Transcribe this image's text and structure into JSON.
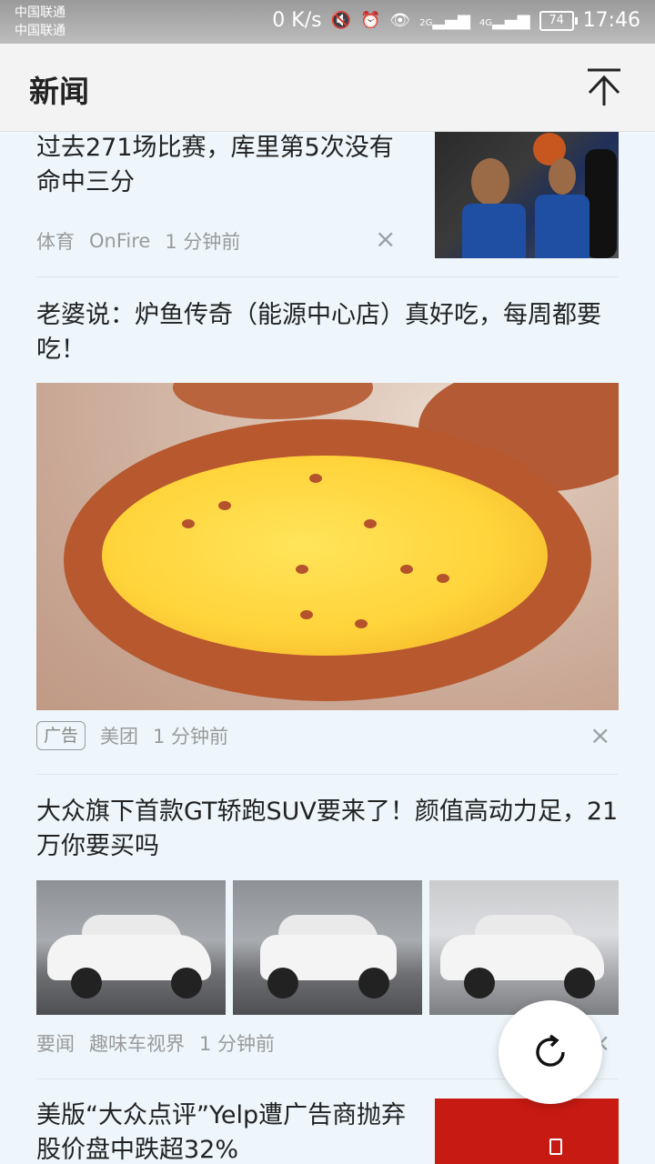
{
  "status_bar": {
    "carrier_1": "中国联通",
    "carrier_2": "中国联通",
    "speed": "0 K/s",
    "network_1": "2G",
    "network_2": "4G",
    "battery": "74",
    "time": "17:46"
  },
  "app_bar": {
    "title": "新闻",
    "back_to_top_icon": "arrow-up-to-top-icon"
  },
  "feed": [
    {
      "headline": "过去271场比赛，库里第5次没有命中三分",
      "category": "体育",
      "source": "OnFire",
      "time": "1 分钟前",
      "close": "×"
    },
    {
      "headline": "老婆说：炉鱼传奇（能源中心店）真好吃，每周都要吃！",
      "badge": "广告",
      "source": "美团",
      "time": "1 分钟前",
      "close": "×"
    },
    {
      "headline": "大众旗下首款GT轿跑SUV要来了！颜值高动力足，21万你要买吗",
      "category": "要闻",
      "source": "趣味车视界",
      "time": "1 分钟前",
      "close": "×"
    },
    {
      "headline": "美版“大众点评”Yelp遭广告商抛弃 股价盘中跌超32%"
    }
  ],
  "refresh_button_icon": "refresh-icon"
}
